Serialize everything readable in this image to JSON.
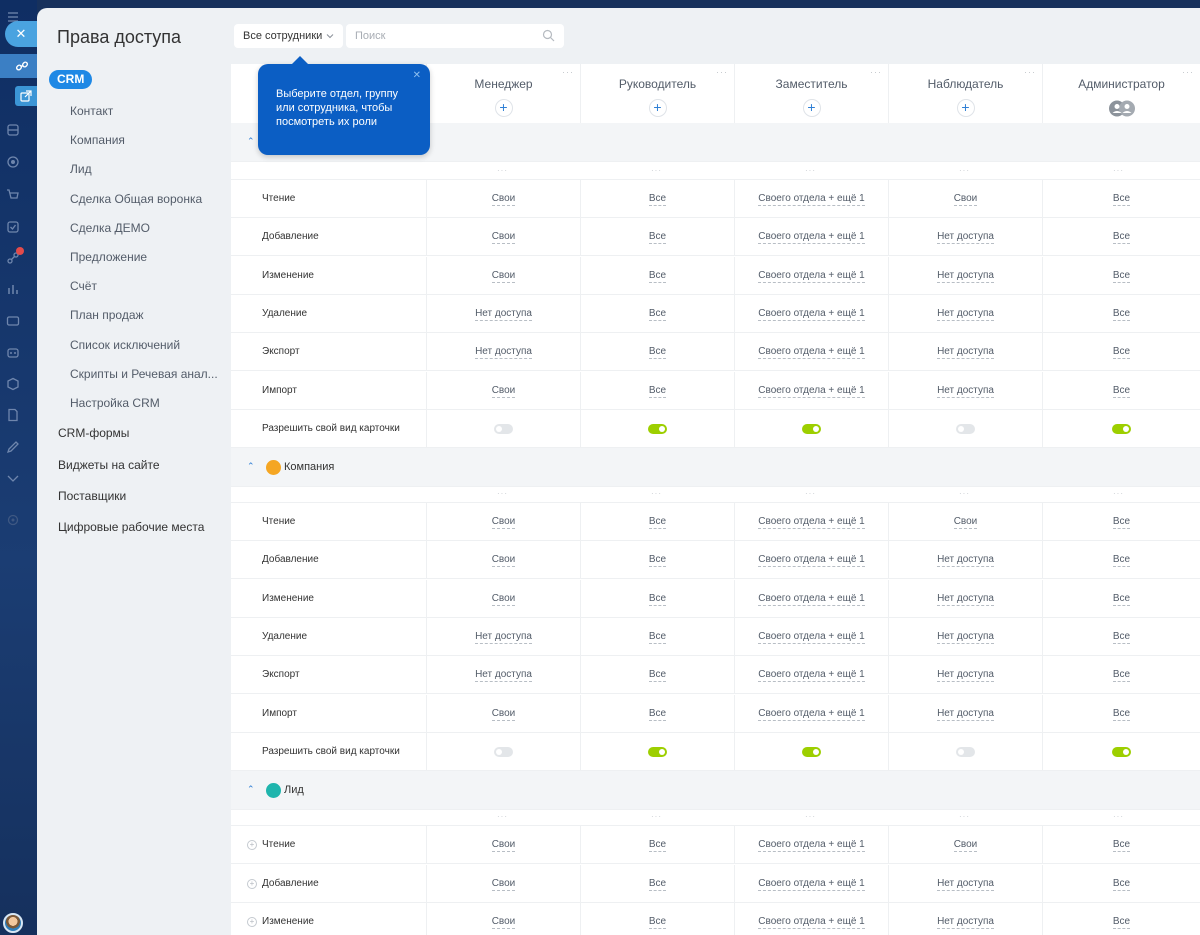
{
  "page": {
    "title": "Права доступа"
  },
  "nav": {
    "crm_label": "CRM",
    "sub_items": [
      "Контакт",
      "Компания",
      "Лид",
      "Сделка Общая воронка",
      "Сделка ДЕМО",
      "Предложение",
      "Счёт",
      "План продаж",
      "Список исключений",
      "Скрипты и Речевая анал...",
      "Настройка CRM"
    ],
    "top_items": [
      "CRM-формы",
      "Виджеты на сайте",
      "Поставщики",
      "Цифровые рабочие места"
    ]
  },
  "toolbar": {
    "filter_label": "Все сотрудники",
    "search_placeholder": "Поиск"
  },
  "tooltip": {
    "text": "Выберите отдел, группу или сотрудника, чтобы посмотреть их роли"
  },
  "roles": [
    "Менеджер",
    "Руководитель",
    "Заместитель",
    "Наблюдатель",
    "Администратор"
  ],
  "sections": [
    {
      "label": "",
      "icon_color": "#8bc34a",
      "rows": [
        {
          "label": "Чтение",
          "values": [
            "Свои",
            "Все",
            "Своего отдела + ещё 1",
            "Свои",
            "Все"
          ]
        },
        {
          "label": "Добавление",
          "values": [
            "Свои",
            "Все",
            "Своего отдела + ещё 1",
            "Нет доступа",
            "Все"
          ]
        },
        {
          "label": "Изменение",
          "values": [
            "Свои",
            "Все",
            "Своего отдела + ещё 1",
            "Нет доступа",
            "Все"
          ]
        },
        {
          "label": "Удаление",
          "values": [
            "Нет доступа",
            "Все",
            "Своего отдела + ещё 1",
            "Нет доступа",
            "Все"
          ]
        },
        {
          "label": "Экспорт",
          "values": [
            "Нет доступа",
            "Все",
            "Своего отдела + ещё 1",
            "Нет доступа",
            "Все"
          ]
        },
        {
          "label": "Импорт",
          "values": [
            "Свои",
            "Все",
            "Своего отдела + ещё 1",
            "Нет доступа",
            "Все"
          ]
        },
        {
          "label": "Разрешить свой вид карточки",
          "toggles": [
            false,
            true,
            true,
            false,
            true
          ]
        }
      ]
    },
    {
      "label": "Компания",
      "icon_color": "#f5a623",
      "rows": [
        {
          "label": "Чтение",
          "values": [
            "Свои",
            "Все",
            "Своего отдела + ещё 1",
            "Свои",
            "Все"
          ]
        },
        {
          "label": "Добавление",
          "values": [
            "Свои",
            "Все",
            "Своего отдела + ещё 1",
            "Нет доступа",
            "Все"
          ]
        },
        {
          "label": "Изменение",
          "values": [
            "Свои",
            "Все",
            "Своего отдела + ещё 1",
            "Нет доступа",
            "Все"
          ]
        },
        {
          "label": "Удаление",
          "values": [
            "Нет доступа",
            "Все",
            "Своего отдела + ещё 1",
            "Нет доступа",
            "Все"
          ]
        },
        {
          "label": "Экспорт",
          "values": [
            "Нет доступа",
            "Все",
            "Своего отдела + ещё 1",
            "Нет доступа",
            "Все"
          ]
        },
        {
          "label": "Импорт",
          "values": [
            "Свои",
            "Все",
            "Своего отдела + ещё 1",
            "Нет доступа",
            "Все"
          ]
        },
        {
          "label": "Разрешить свой вид карточки",
          "toggles": [
            false,
            true,
            true,
            false,
            true
          ]
        }
      ]
    },
    {
      "label": "Лид",
      "icon_color": "#1fb5ad",
      "rows": [
        {
          "label": "Чтение",
          "values": [
            "Свои",
            "Все",
            "Своего отдела + ещё 1",
            "Свои",
            "Все"
          ]
        },
        {
          "label": "Добавление",
          "values": [
            "Свои",
            "Все",
            "Своего отдела + ещё 1",
            "Нет доступа",
            "Все"
          ]
        },
        {
          "label": "Изменение",
          "values": [
            "Свои",
            "Все",
            "Своего отдела + ещё 1",
            "Нет доступа",
            "Все"
          ]
        }
      ]
    }
  ],
  "colors": {
    "accent": "#1e88e5",
    "toggle_on": "#9dcf00",
    "tooltip_bg": "#0b5ec4"
  }
}
